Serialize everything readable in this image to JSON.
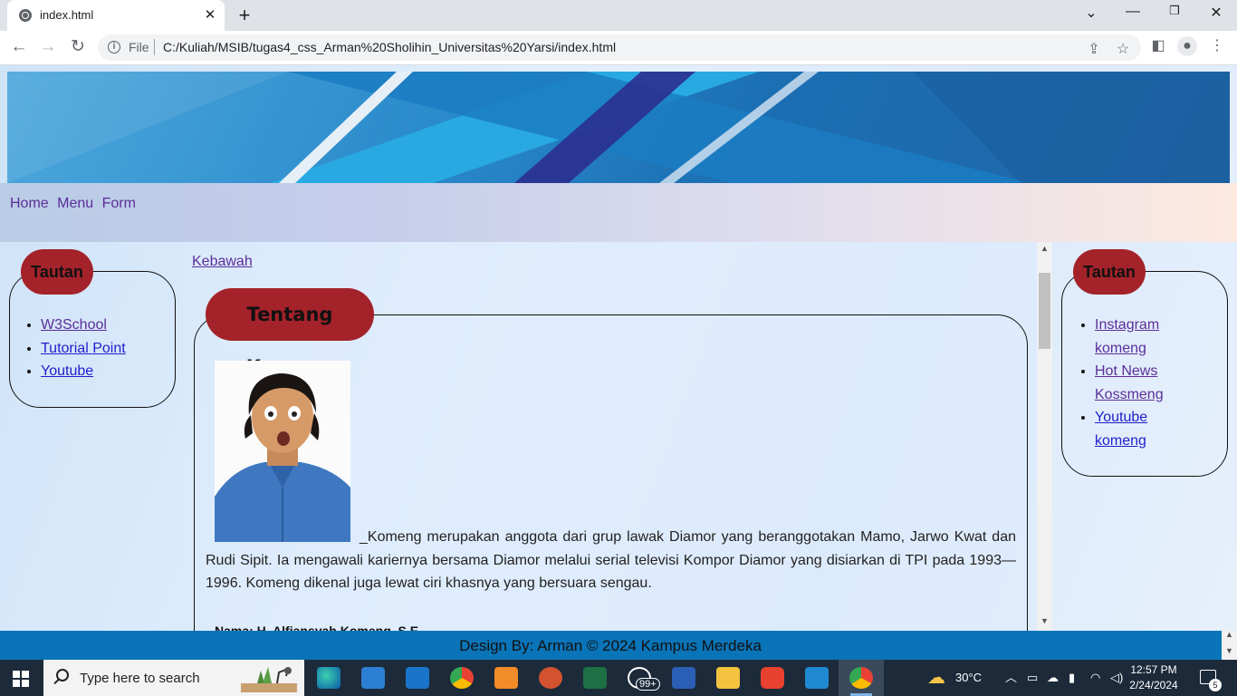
{
  "browser": {
    "tab_title": "index.html",
    "url_scheme": "File",
    "url": "C:/Kuliah/MSIB/tugas4_css_Arman%20Sholihin_Universitas%20Yarsi/index.html"
  },
  "page": {
    "nav": [
      "Home",
      "Menu",
      "Form"
    ],
    "left_sidebar": {
      "title": "Tautan",
      "links": [
        "W3School",
        "Tutorial Point",
        "Youtube"
      ]
    },
    "main": {
      "anchor_link": "Kebawah",
      "about_title": "Tentang Komeng",
      "about_text": "_Komeng merupakan anggota dari grup lawak Diamor yang beranggotakan Mamo, Jarwo Kwat dan Rudi Sipit. Ia mengawali kariernya bersama Diamor melalui serial televisi Kompor Diamor yang disiarkan di TPI pada 1993—1996. Komeng dikenal juga lewat ciri khasnya yang bersuara sengau.",
      "name_line": "Nama: H. Alfiansyah Komeng, S.E."
    },
    "right_sidebar": {
      "title": "Tautan",
      "links": [
        "Instagram komeng",
        "Hot News Kossmeng",
        "Youtube komeng"
      ]
    },
    "footer": "Design By: Arman © 2024 Kampus Merdeka"
  },
  "taskbar": {
    "search_placeholder": "Type here to search",
    "whatsapp_badge": "99+",
    "weather": "30°C",
    "time": "12:57 PM",
    "date": "2/24/2024",
    "notification_count": "5"
  },
  "colors": {
    "badge_red": "#a4222a",
    "footer_blue": "#0a74b8",
    "visited_link": "#5b2e99",
    "link_blue": "#1f1fcb"
  }
}
